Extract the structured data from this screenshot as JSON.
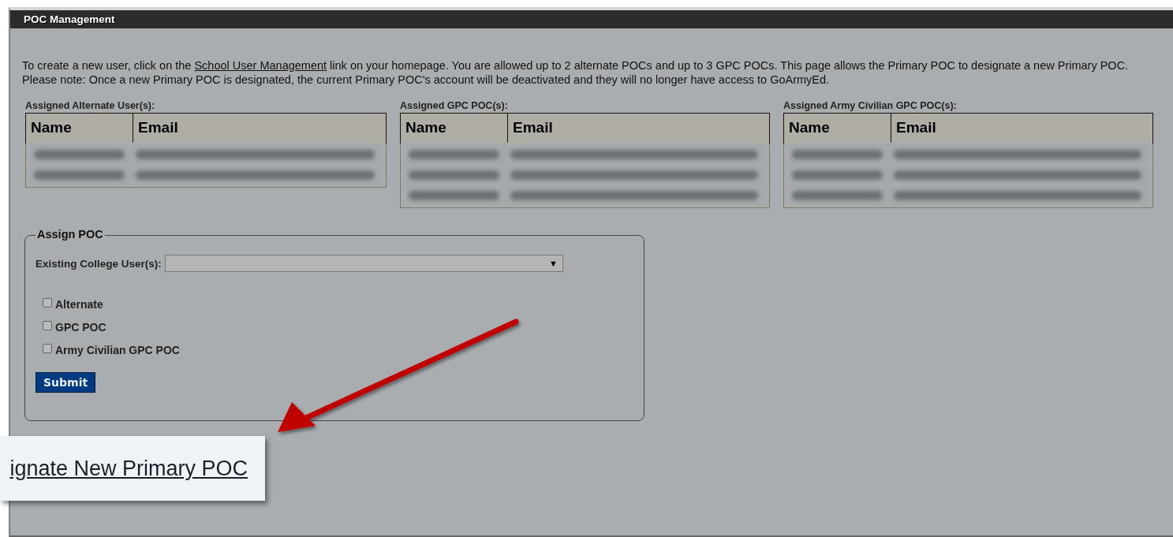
{
  "window": {
    "title": "POC Management"
  },
  "intro": {
    "before": "To create a new user, click on the ",
    "link": "School User Management",
    "after": " link on your homepage. You are allowed up to 2 alternate POCs and up to 3 GPC POCs. This page allows the Primary POC to designate a new Primary POC. Please note: Once a new Primary POC is designated, the current Primary POC's account will be deactivated and they will no longer have access to GoArmyEd."
  },
  "tables": [
    {
      "label": "Assigned Alternate User(s):",
      "columns": [
        "Name",
        "Email"
      ],
      "rows": [
        {
          "kind": "redacted"
        },
        {
          "kind": "redacted"
        }
      ]
    },
    {
      "label": "Assigned GPC POC(s):",
      "columns": [
        "Name",
        "Email"
      ],
      "rows": [
        {
          "kind": "redacted"
        },
        {
          "kind": "redacted"
        },
        {
          "kind": "redacted"
        }
      ]
    },
    {
      "label": "Assigned Army Civilian GPC POC(s):",
      "columns": [
        "Name",
        "Email"
      ],
      "rows": [
        {
          "kind": "redacted"
        },
        {
          "kind": "redacted"
        },
        {
          "kind": "redacted"
        }
      ]
    }
  ],
  "assign_form": {
    "legend": "Assign POC",
    "select_label": "Existing College User(s):",
    "dropdown_arrow": "▼",
    "checkboxes": [
      {
        "label": "Alternate",
        "checked": false
      },
      {
        "label": "GPC POC",
        "checked": false
      },
      {
        "label": "Army Civilian GPC POC",
        "checked": false
      }
    ],
    "submit": "Submit"
  },
  "callout": {
    "link": "ignate New Primary POC"
  }
}
